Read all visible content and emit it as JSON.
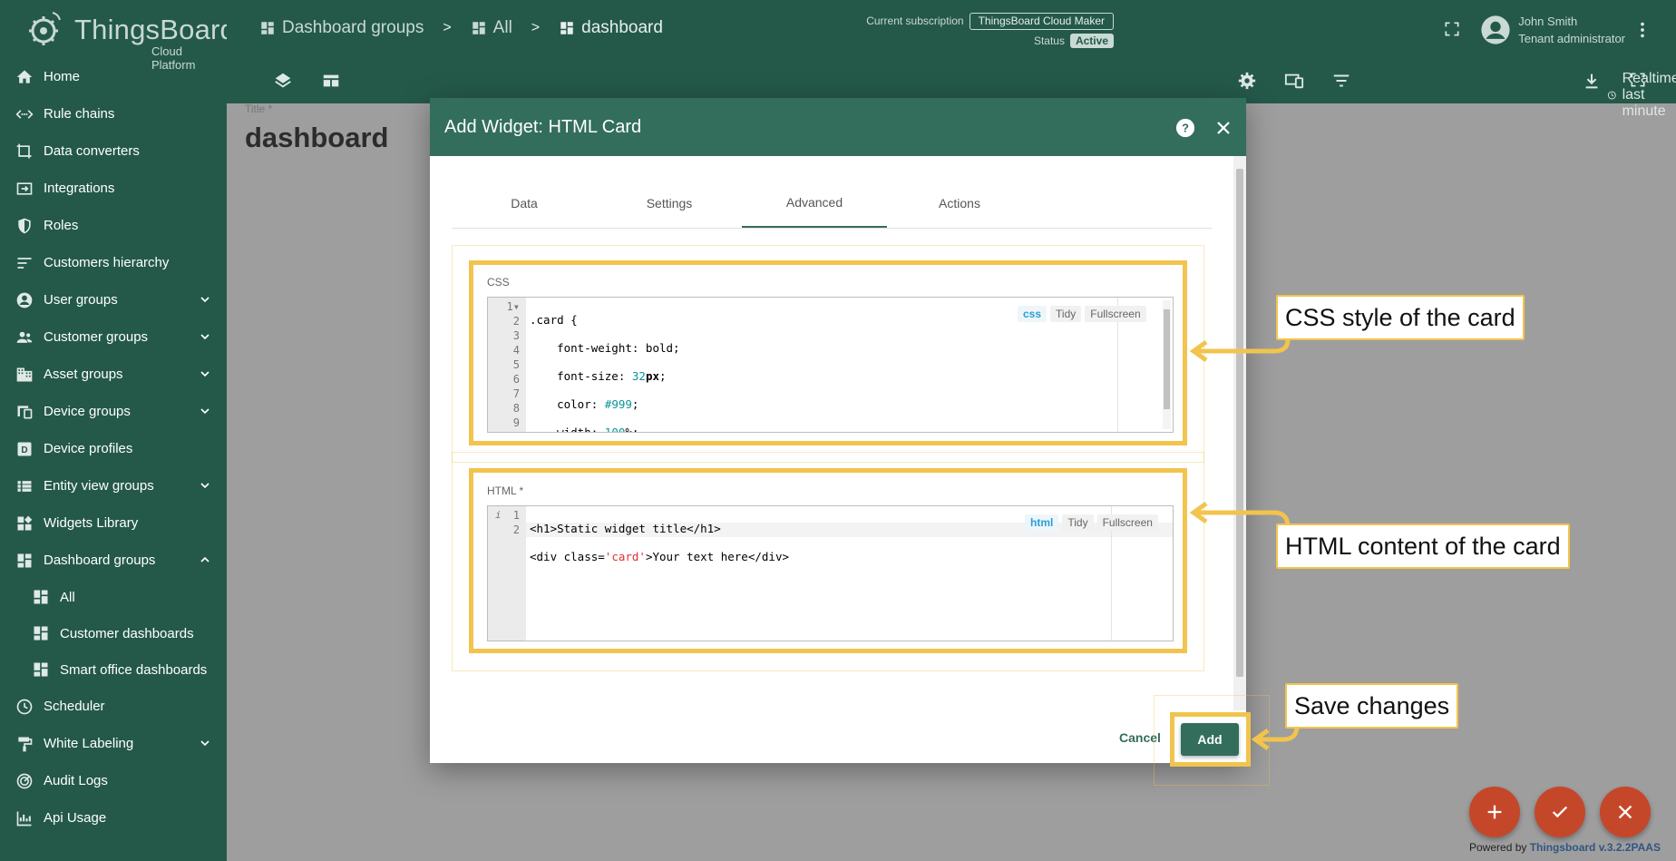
{
  "app": {
    "brand": "ThingsBoard",
    "brand_sub": "Cloud Platform",
    "powered_prefix": "Powered by",
    "powered_link": "Thingsboard v.3.2.2PAAS"
  },
  "breadcrumbs": [
    "Dashboard groups",
    "All",
    "dashboard"
  ],
  "breadcrumb_sep": ">",
  "subscription": {
    "label": "Current subscription",
    "plan": "ThingsBoard Cloud Maker",
    "status_label": "Status",
    "status": "Active"
  },
  "user": {
    "name": "John Smith",
    "role": "Tenant administrator"
  },
  "toolbar": {
    "realtime": "Realtime - last minute"
  },
  "sidebar": {
    "items": [
      {
        "label": "Home",
        "icon": "home-icon"
      },
      {
        "label": "Rule chains",
        "icon": "rule-chains-icon"
      },
      {
        "label": "Data converters",
        "icon": "converter-icon"
      },
      {
        "label": "Integrations",
        "icon": "integration-icon"
      },
      {
        "label": "Roles",
        "icon": "shield-icon"
      },
      {
        "label": "Customers hierarchy",
        "icon": "hierarchy-icon"
      },
      {
        "label": "User groups",
        "icon": "account-icon"
      },
      {
        "label": "Customer groups",
        "icon": "people-icon"
      },
      {
        "label": "Asset groups",
        "icon": "domain-icon"
      },
      {
        "label": "Device groups",
        "icon": "devices-icon"
      },
      {
        "label": "Device profiles",
        "icon": "device-profile-icon"
      },
      {
        "label": "Entity view groups",
        "icon": "view-list-icon"
      },
      {
        "label": "Widgets Library",
        "icon": "widgets-icon"
      },
      {
        "label": "Dashboard groups",
        "icon": "dashboard-icon"
      },
      {
        "label": "All",
        "icon": "dashboard-icon"
      },
      {
        "label": "Customer dashboards",
        "icon": "dashboard-icon"
      },
      {
        "label": "Smart office dashboards",
        "icon": "dashboard-icon"
      },
      {
        "label": "Scheduler",
        "icon": "clock-icon"
      },
      {
        "label": "White Labeling",
        "icon": "paint-icon"
      },
      {
        "label": "Audit Logs",
        "icon": "track-changes-icon"
      },
      {
        "label": "Api Usage",
        "icon": "api-usage-icon"
      }
    ]
  },
  "content": {
    "title_label": "Title *",
    "title": "dashboard"
  },
  "dialog": {
    "title": "Add Widget: HTML Card",
    "tabs": [
      "Data",
      "Settings",
      "Advanced",
      "Actions"
    ],
    "active_tab": "Advanced",
    "css_label": "CSS",
    "html_label": "HTML *",
    "editor_lang_css": "css",
    "editor_lang_html": "html",
    "tidy": "Tidy",
    "fullscreen": "Fullscreen",
    "cancel": "Cancel",
    "add": "Add"
  },
  "callouts": {
    "css": "CSS style of the card",
    "html": "HTML content of the card",
    "save": "Save changes"
  },
  "colors": {
    "primary": "#24594a",
    "dialog_header": "#336e5d",
    "highlight": "#f2c44d",
    "fab": "#c5472a"
  }
}
